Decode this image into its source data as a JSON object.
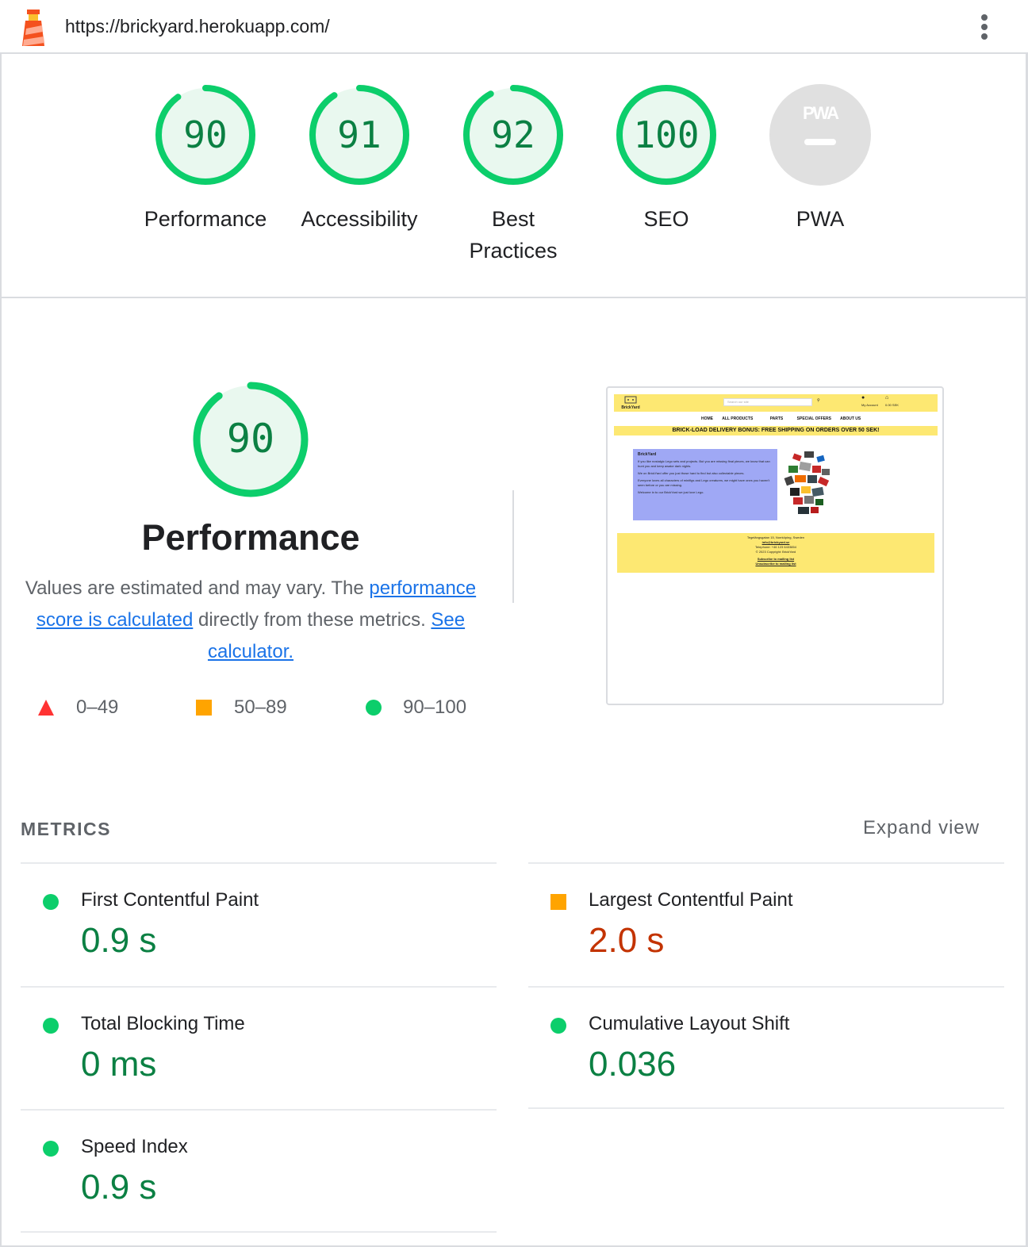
{
  "url": "https://brickyard.herokuapp.com/",
  "icons": {
    "logo": "lighthouse-icon",
    "menu": "more-vert-icon"
  },
  "colors": {
    "pass": "#0cce6b",
    "pass_text": "#0b8043",
    "average": "#ffa400",
    "average_text": "#c33300",
    "fail": "#ff3333",
    "link": "#1a73e8"
  },
  "categories": [
    {
      "label": "Performance",
      "score": 90
    },
    {
      "label": "Accessibility",
      "score": 91
    },
    {
      "label": "Best Practices",
      "score": 92
    },
    {
      "label": "SEO",
      "score": 100
    },
    {
      "label": "PWA",
      "score": null,
      "badge": "PWA"
    }
  ],
  "performance": {
    "score": "90",
    "title": "Performance",
    "desc_prefix": "Values are estimated and may vary. The ",
    "desc_link1": "performance score is calculated",
    "desc_middle": " directly from these metrics. ",
    "desc_link2": "See calculator.",
    "legend": [
      {
        "shape": "triangle",
        "range": "0–49"
      },
      {
        "shape": "square",
        "range": "50–89"
      },
      {
        "shape": "circle",
        "range": "90–100"
      }
    ]
  },
  "screenshot": {
    "logo_text": "BrickYard",
    "search_placeholder": "Search our site",
    "account": "My Account",
    "cart": "0.00 SEK",
    "nav": [
      "HOME",
      "ALL PRODUCTS",
      "PARTS",
      "SPECIAL OFFERS",
      "ABOUT US"
    ],
    "banner": "BRICK-LOAD DELIVERY BONUS: FREE SHIPPING ON ORDERS OVER 50 SEK!",
    "box_title": "BrickYard",
    "box_p1": "If you like nostalgic Lego sets and projects. But you are missing final pieces, we know that can hunt you and keep awake dark nights.",
    "box_p2": "We on BrickYard offer you just those hard to find but also collectable pieces.",
    "box_p3": "Everyone loves all characters of minifigs and Lego creatures, we might have ones you haven't seen before or you are missing.",
    "box_p4": "Welcome in to our BrickYard we just love Lego.",
    "footer_addr": "Tegelängsgatan 15, Norrköping, Sweden",
    "footer_email": "info@brickyard.se",
    "footer_phone": "Telephone: +46 123 6433854",
    "footer_copy": "© 2023 Copyright: BrickYard",
    "footer_sub": "Subscribe to mailing list",
    "footer_unsub": "Unsubscribe to mailing list"
  },
  "metrics": {
    "heading": "METRICS",
    "expand": "Expand view",
    "items": [
      {
        "title": "First Contentful Paint",
        "value": "0.9 s",
        "rating": "pass"
      },
      {
        "title": "Largest Contentful Paint",
        "value": "2.0 s",
        "rating": "average"
      },
      {
        "title": "Total Blocking Time",
        "value": "0 ms",
        "rating": "pass"
      },
      {
        "title": "Cumulative Layout Shift",
        "value": "0.036",
        "rating": "pass"
      },
      {
        "title": "Speed Index",
        "value": "0.9 s",
        "rating": "pass"
      }
    ]
  }
}
